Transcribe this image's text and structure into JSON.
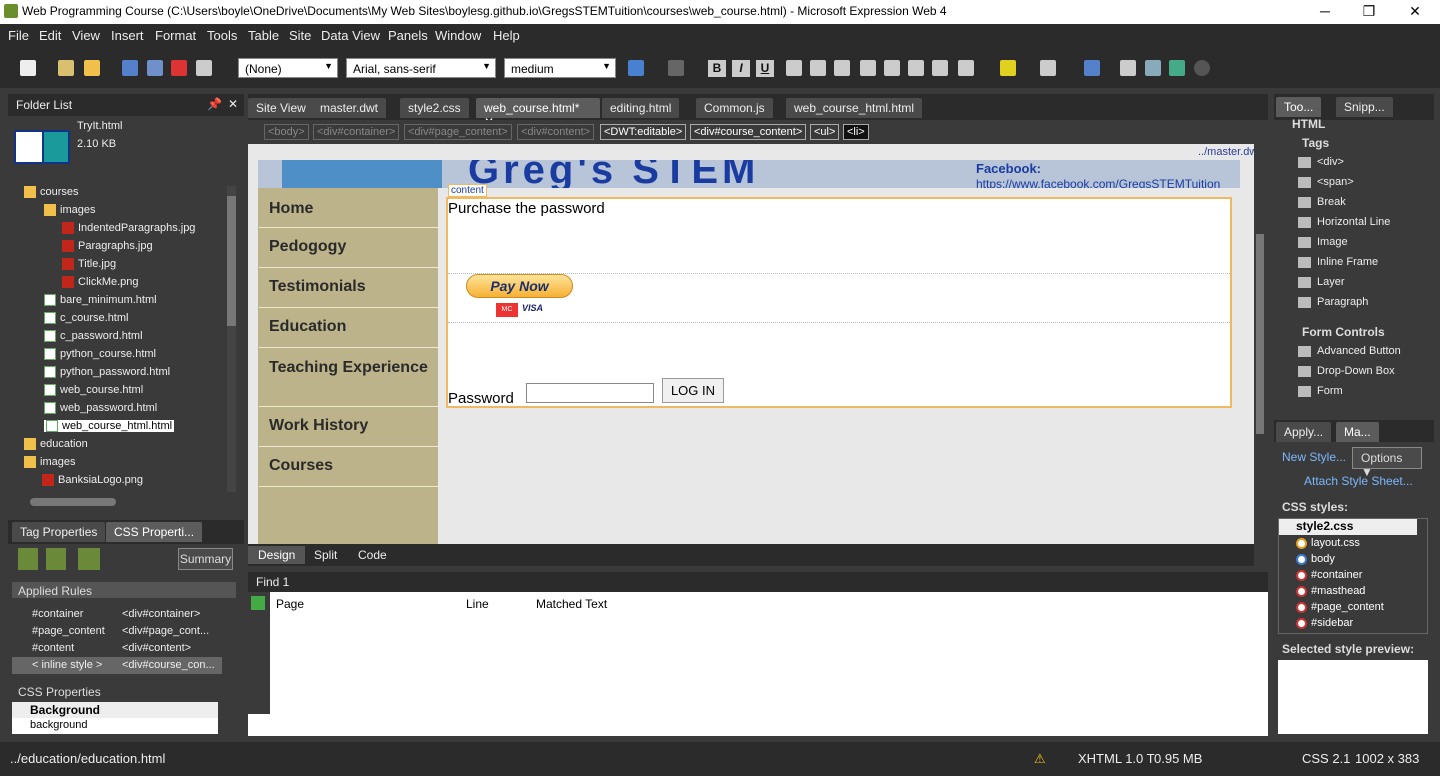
{
  "window": {
    "title": "Web Programming Course (C:\\Users\\boyle\\OneDrive\\Documents\\My Web Sites\\boylesg.github.io\\GregsSTEMTuition\\courses\\web_course.html) - Microsoft Expression Web 4",
    "minimize": "─",
    "restore": "❐",
    "close": "✕"
  },
  "menu": [
    "File",
    "Edit",
    "View",
    "Insert",
    "Format",
    "Tools",
    "Table",
    "Site",
    "Data View",
    "Panels",
    "Window",
    "Help"
  ],
  "toolbar": {
    "style": "(None)",
    "font": "Arial, sans-serif",
    "size": "medium",
    "bold": "B",
    "italic": "I",
    "underline": "U"
  },
  "folder_list": {
    "title": "Folder List",
    "preview_name": "TryIt.html",
    "preview_size": "2.10 KB",
    "items": [
      "courses",
      "images",
      "IndentedParagraphs.jpg",
      "Paragraphs.jpg",
      "Title.jpg",
      "ClickMe.png",
      "bare_minimum.html",
      "c_course.html",
      "c_password.html",
      "python_course.html",
      "python_password.html",
      "web_course.html",
      "web_password.html",
      "web_course_html.html",
      "education",
      "images",
      "BanksiaLogo.png"
    ]
  },
  "doc_tabs": [
    "Site View",
    "master.dwt",
    "style2.css",
    "web_course.html*",
    "editing.html",
    "Common.js",
    "web_course_html.html"
  ],
  "breadcrumb": [
    "<body>",
    "<div#container>",
    "<div#page_content>",
    "<div#content>",
    "<DWT:editable>",
    "<div#course_content>",
    "<ul>",
    "<li>"
  ],
  "master_link": "../master.dwt",
  "page": {
    "banner": "Greg's STEM",
    "facebook_label": "Facebook:",
    "facebook_url": "https://www.facebook.com/GregsSTEMTuition",
    "content_tag": "content",
    "sidebar": [
      "Home",
      "Pedogogy",
      "Testimonials",
      "Education",
      "Teaching Experience",
      "Work History",
      "Courses"
    ],
    "purchase_text": "Purchase the password",
    "pay_now": "Pay Now",
    "mastercard": "MC",
    "visa": "VISA",
    "password_label": "Password",
    "login": "LOG IN"
  },
  "view_tabs": [
    "Design",
    "Split",
    "Code"
  ],
  "tag_props": {
    "tab1": "Tag Properties",
    "tab2": "CSS Properti...",
    "summary": "Summary",
    "applied_rules": "Applied Rules",
    "rules": [
      [
        "#container",
        "<div#container>"
      ],
      [
        "#page_content",
        "<div#page_cont..."
      ],
      [
        "#content",
        "<div#content>"
      ],
      [
        "< inline style >",
        "<div#course_con..."
      ]
    ],
    "css_props": "CSS Properties",
    "background_group": "Background",
    "background": "background"
  },
  "find": {
    "title": "Find 1",
    "cols": [
      "Page",
      "Line",
      "Matched Text"
    ]
  },
  "toolbox": {
    "tab1": "Too...",
    "tab2": "Snipp...",
    "html": "HTML",
    "tags": "Tags",
    "tag_items": [
      "<div>",
      "<span>",
      "Break",
      "Horizontal Line",
      "Image",
      "Inline Frame",
      "Layer",
      "Paragraph"
    ],
    "form_controls": "Form Controls",
    "form_items": [
      "Advanced Button",
      "Drop-Down Box",
      "Form"
    ]
  },
  "styles": {
    "tab1": "Apply...",
    "tab2": "Ma...",
    "new_style": "New Style...",
    "options": "Options",
    "attach": "Attach Style Sheet...",
    "css_styles": "CSS styles:",
    "sheet": "style2.css",
    "items": [
      "layout.css",
      "body",
      "#container",
      "#masthead",
      "#page_content",
      "#sidebar"
    ],
    "preview": "Selected style preview:"
  },
  "status": {
    "path": "../education/education.html",
    "doctype": "XHTML 1.0 T",
    "size": "0.95 MB",
    "css": "CSS 2.1",
    "dims": "1002 x 383"
  }
}
